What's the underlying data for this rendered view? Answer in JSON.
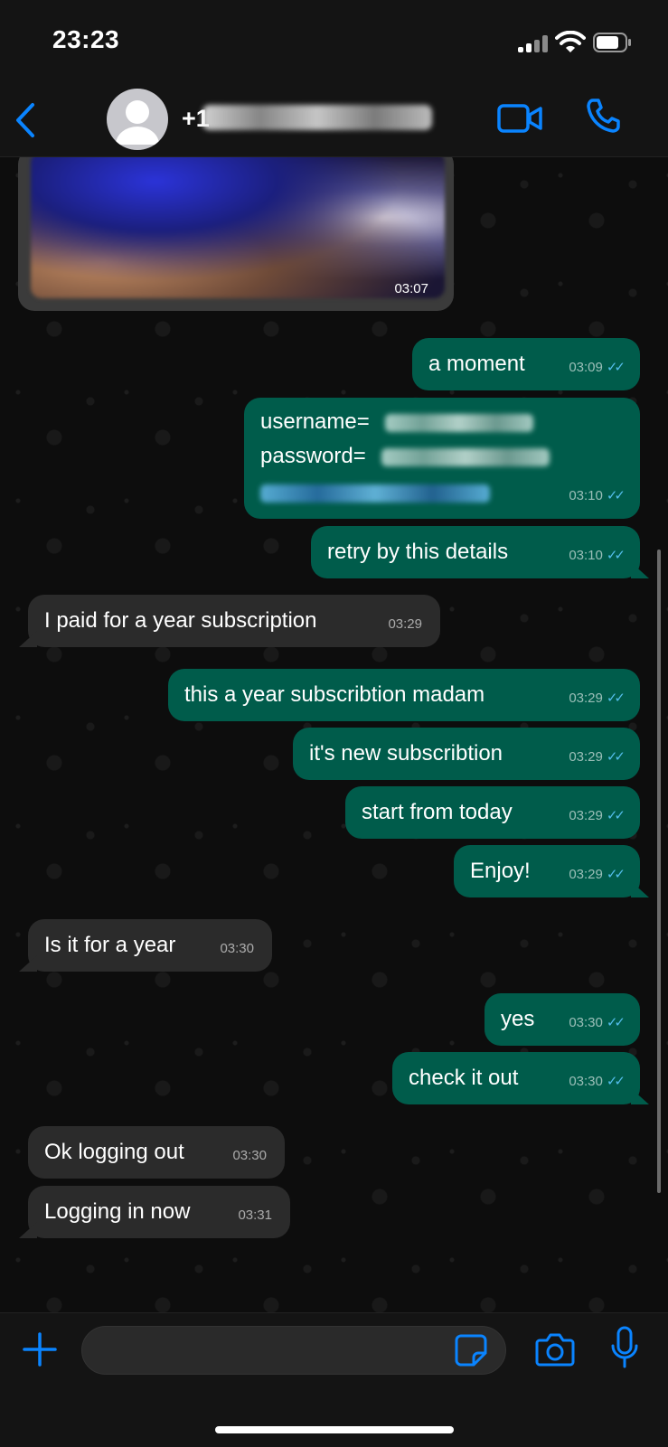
{
  "status_bar": {
    "time": "23:23"
  },
  "header": {
    "contact_prefix": "+1",
    "icons": [
      "back-chevron-icon",
      "avatar-placeholder",
      "video-call-icon",
      "phone-call-icon"
    ],
    "accent_color": "#0a84ff"
  },
  "messages": [
    {
      "type": "image",
      "direction": "in",
      "time": "03:07"
    },
    {
      "direction": "out",
      "text": "a moment",
      "time": "03:09",
      "ticks": "✓✓"
    },
    {
      "direction": "out",
      "lines": [
        "username=",
        "password="
      ],
      "time": "03:10",
      "ticks": "✓✓"
    },
    {
      "direction": "out",
      "text": "retry by this details",
      "time": "03:10",
      "ticks": "✓✓"
    },
    {
      "direction": "in",
      "text": "I paid for a year subscription",
      "time": "03:29"
    },
    {
      "direction": "out",
      "text": "this a year subscribtion madam",
      "time": "03:29",
      "ticks": "✓✓"
    },
    {
      "direction": "out",
      "text": "it's new subscribtion",
      "time": "03:29",
      "ticks": "✓✓"
    },
    {
      "direction": "out",
      "text": "start from today",
      "time": "03:29",
      "ticks": "✓✓"
    },
    {
      "direction": "out",
      "text": "Enjoy!",
      "time": "03:29",
      "ticks": "✓✓"
    },
    {
      "direction": "in",
      "text": "Is it for a year",
      "time": "03:30"
    },
    {
      "direction": "out",
      "text": "yes",
      "time": "03:30",
      "ticks": "✓✓"
    },
    {
      "direction": "out",
      "text": "check it out",
      "time": "03:30",
      "ticks": "✓✓"
    },
    {
      "direction": "in",
      "text": "Ok logging out",
      "time": "03:30"
    },
    {
      "direction": "in",
      "text": "Logging in now",
      "time": "03:31"
    }
  ],
  "colors": {
    "outgoing_bubble": "#005c4b",
    "incoming_bubble": "#2b2b2b",
    "read_ticks": "#53bdeb"
  },
  "input_bar": {
    "value": "",
    "icons": [
      "plus-icon",
      "sticker-icon",
      "camera-icon",
      "microphone-icon"
    ]
  }
}
